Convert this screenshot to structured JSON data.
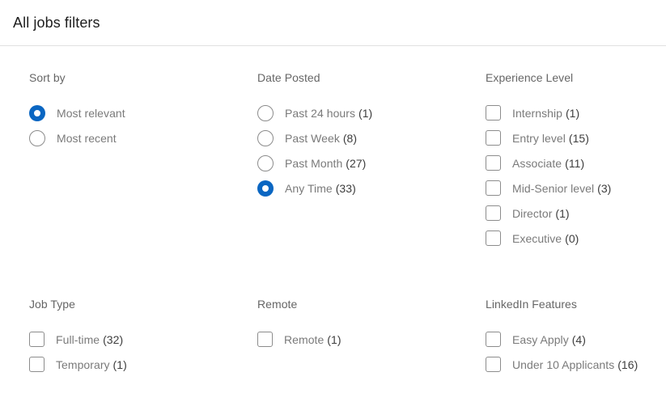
{
  "header": {
    "title": "All jobs filters"
  },
  "groups": [
    {
      "id": "sort-by",
      "title": "Sort by",
      "control": "radio",
      "options": [
        {
          "label": "Most relevant",
          "count": "",
          "checked": true
        },
        {
          "label": "Most recent",
          "count": "",
          "checked": false
        }
      ]
    },
    {
      "id": "date-posted",
      "title": "Date Posted",
      "control": "radio",
      "options": [
        {
          "label": "Past 24 hours",
          "count": "(1)",
          "checked": false
        },
        {
          "label": "Past Week",
          "count": "(8)",
          "checked": false
        },
        {
          "label": "Past Month",
          "count": "(27)",
          "checked": false
        },
        {
          "label": "Any Time",
          "count": "(33)",
          "checked": true
        }
      ]
    },
    {
      "id": "experience-level",
      "title": "Experience Level",
      "control": "checkbox",
      "options": [
        {
          "label": "Internship",
          "count": "(1)",
          "checked": false
        },
        {
          "label": "Entry level",
          "count": "(15)",
          "checked": false
        },
        {
          "label": "Associate",
          "count": "(11)",
          "checked": false
        },
        {
          "label": "Mid-Senior level",
          "count": "(3)",
          "checked": false
        },
        {
          "label": "Director",
          "count": "(1)",
          "checked": false
        },
        {
          "label": "Executive",
          "count": "(0)",
          "checked": false
        }
      ]
    },
    {
      "id": "job-type",
      "title": "Job Type",
      "control": "checkbox",
      "options": [
        {
          "label": "Full-time",
          "count": "(32)",
          "checked": false
        },
        {
          "label": "Temporary",
          "count": "(1)",
          "checked": false
        }
      ]
    },
    {
      "id": "remote",
      "title": "Remote",
      "control": "checkbox",
      "options": [
        {
          "label": "Remote",
          "count": "(1)",
          "checked": false
        }
      ]
    },
    {
      "id": "linkedin-features",
      "title": "LinkedIn Features",
      "control": "checkbox",
      "options": [
        {
          "label": "Easy Apply",
          "count": "(4)",
          "checked": false
        },
        {
          "label": "Under 10 Applicants",
          "count": "(16)",
          "checked": false
        }
      ]
    }
  ],
  "colors": {
    "accent": "#0a66c2",
    "title_text": "#1d1d1d",
    "group_title_text": "#666666",
    "option_text": "#7a7a7a",
    "count_text": "#3d3d3d",
    "control_border": "#8c8c8c",
    "divider": "#e0e0e0",
    "background": "#ffffff"
  }
}
